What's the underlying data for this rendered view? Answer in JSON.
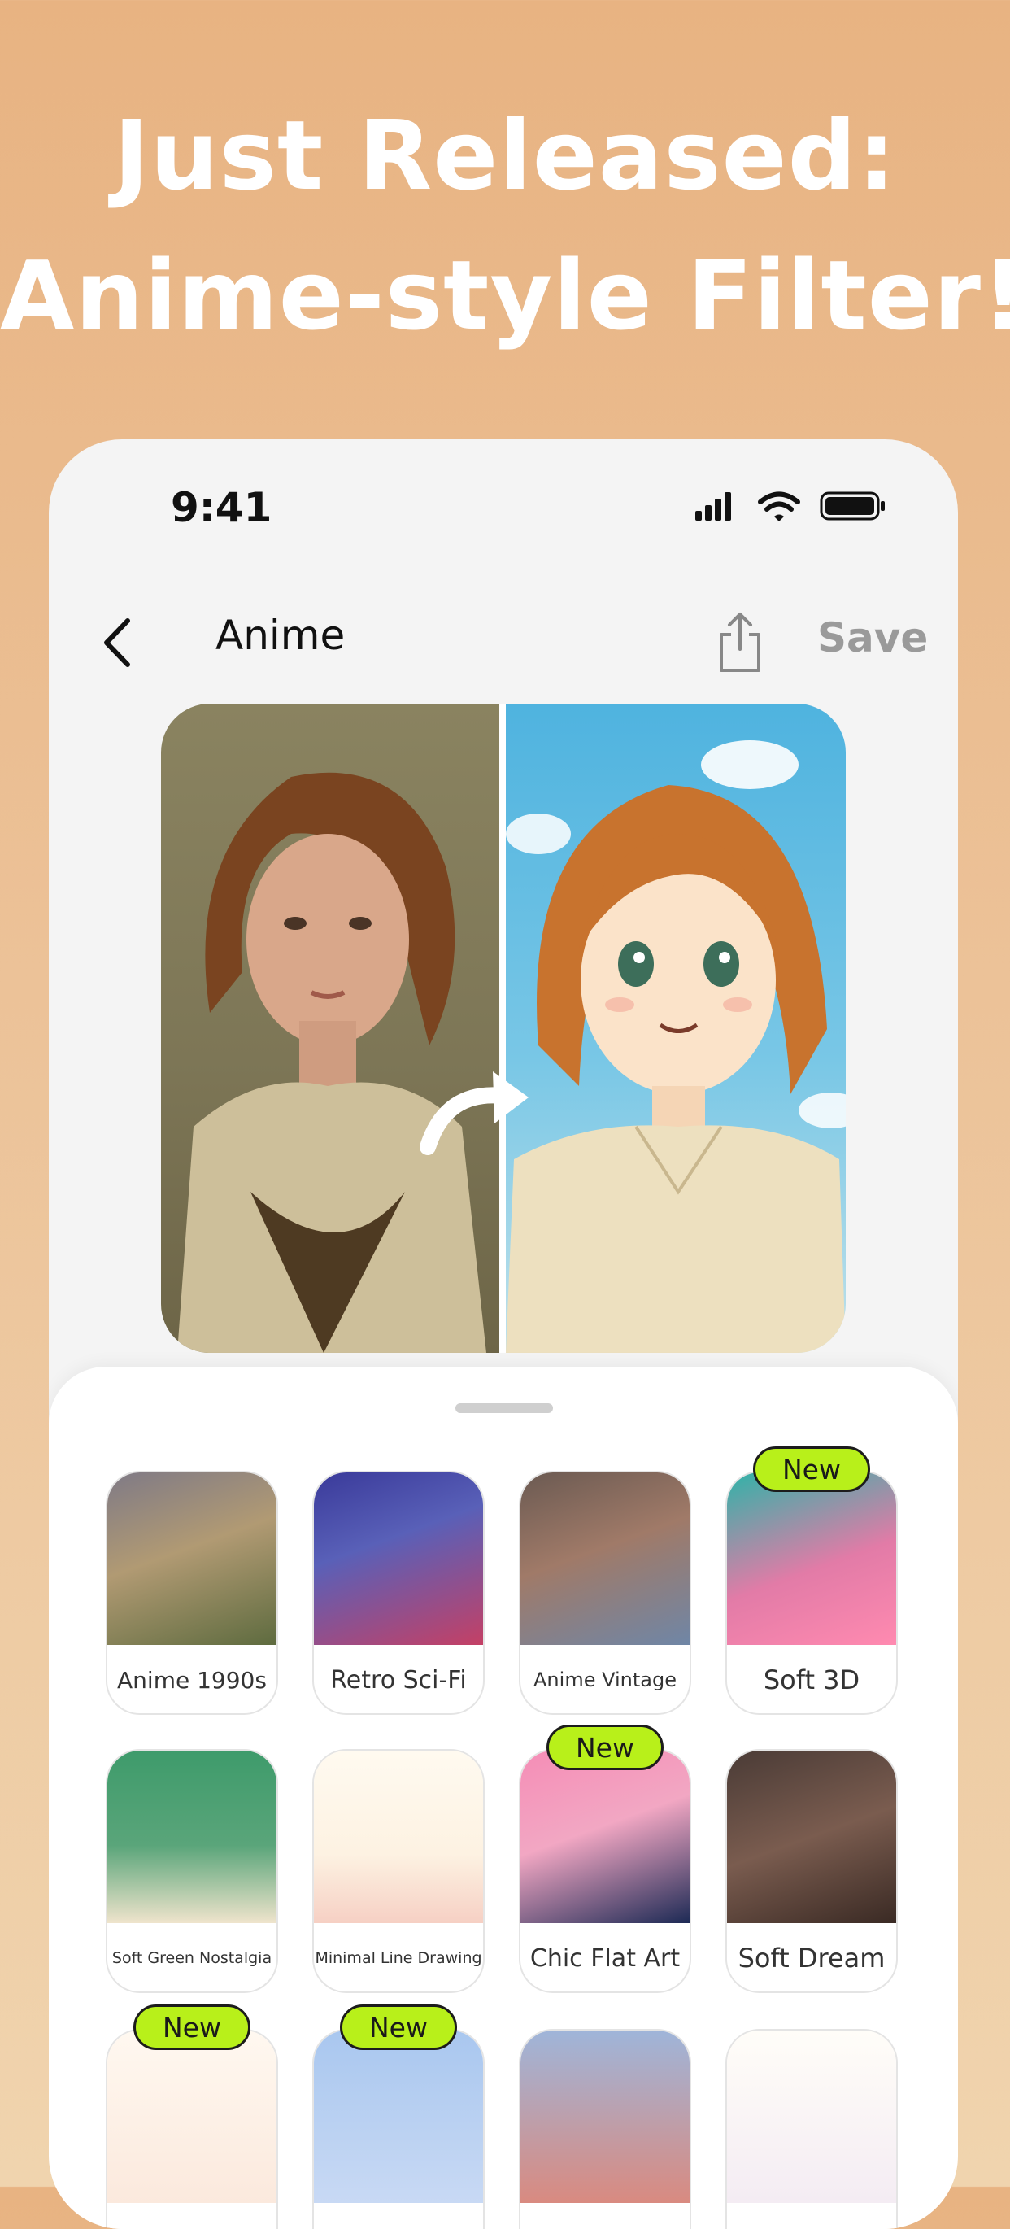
{
  "headline": {
    "line1": "Just Released:",
    "line2": "Anime-style Filter!"
  },
  "status_bar": {
    "time": "9:41"
  },
  "topbar": {
    "title": "Anime",
    "save_label": "Save"
  },
  "badge_label": "New",
  "filters": [
    {
      "label": "Anime 1990s",
      "new": false
    },
    {
      "label": "Retro Sci-Fi",
      "new": false
    },
    {
      "label": "Anime Vintage",
      "new": false
    },
    {
      "label": "Soft 3D",
      "new": true
    },
    {
      "label": "Soft Green Nostalgia",
      "new": false
    },
    {
      "label": "Minimal Line Drawing",
      "new": false
    },
    {
      "label": "Chic Flat Art",
      "new": true
    },
    {
      "label": "Soft Dream",
      "new": false
    },
    {
      "label": "",
      "new": true
    },
    {
      "label": "",
      "new": true
    },
    {
      "label": "",
      "new": false
    },
    {
      "label": "",
      "new": false
    }
  ],
  "colors": {
    "badge": "#b8f01a",
    "save_disabled": "#9a9a9a"
  }
}
